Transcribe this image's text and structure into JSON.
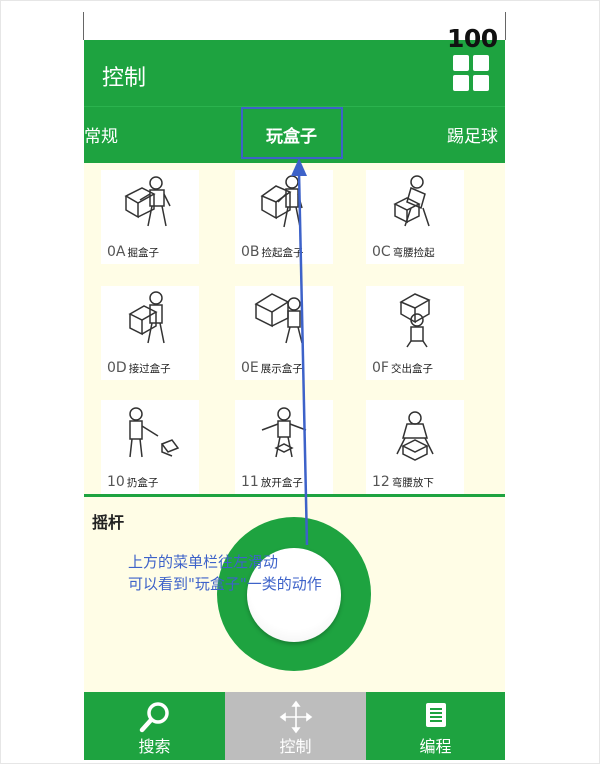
{
  "status": {
    "battery_level": "100"
  },
  "appbar": {
    "title": "控制",
    "menu_icon": "grid-icon"
  },
  "tabs": [
    {
      "label": "常规"
    },
    {
      "label": "玩盒子",
      "selected": true
    },
    {
      "label": "踢足球"
    }
  ],
  "actions": [
    {
      "code": "0A",
      "label": "掘盒子"
    },
    {
      "code": "0B",
      "label": "捡起盒子"
    },
    {
      "code": "0C",
      "label": "弯腰捡起"
    },
    {
      "code": "0D",
      "label": "接过盒子"
    },
    {
      "code": "0E",
      "label": "展示盒子"
    },
    {
      "code": "0F",
      "label": "交出盒子"
    },
    {
      "code": "10",
      "label": "扔盒子"
    },
    {
      "code": "11",
      "label": "放开盒子"
    },
    {
      "code": "12",
      "label": "弯腰放下"
    }
  ],
  "joystick": {
    "title": "摇杆"
  },
  "annotation": {
    "line1": "上方的菜单栏往左滑动",
    "line2": "可以看到\"玩盒子\"一类的动作",
    "color": "#3d62c9"
  },
  "bottom_nav": [
    {
      "label": "搜索",
      "icon": "search-icon"
    },
    {
      "label": "控制",
      "icon": "move-arrows-icon",
      "selected": true
    },
    {
      "label": "编程",
      "icon": "document-list-icon"
    }
  ],
  "colors": {
    "primary": "#1ea340",
    "panel": "#fffde6",
    "selected_nav": "#bdbdbd"
  }
}
